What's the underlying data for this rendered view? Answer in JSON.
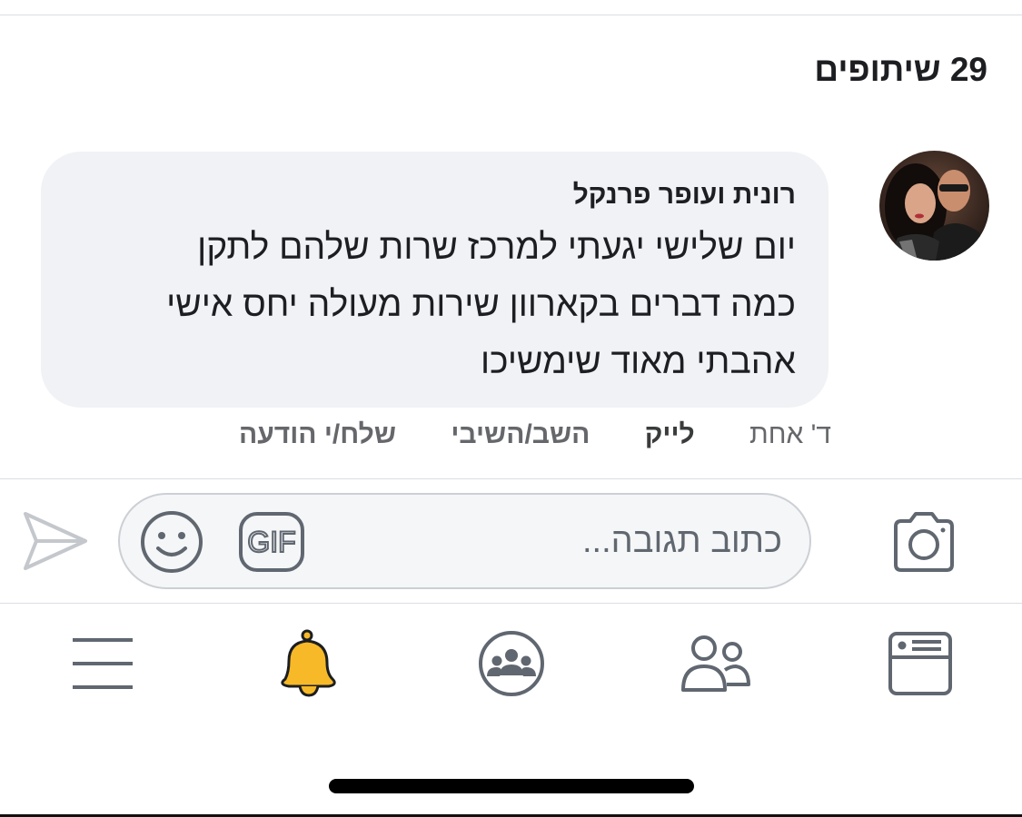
{
  "shares": {
    "label": "29 שיתופים"
  },
  "comment": {
    "author": "רונית ועופר פרנקל",
    "lines": [
      "יום שלישי יגעתי למרכז שרות שלהם לתקן",
      "כמה דברים בקארוון שירות מעולה יחס אישי",
      "אהבתי מאוד שימשיכו"
    ],
    "time": "ד' אחת",
    "like": "לייק",
    "reply": "השב/השיבי",
    "message": "שלח/י הודעה"
  },
  "composer": {
    "placeholder": "כתוב תגובה...",
    "gif_label": "GIF",
    "camera_icon": "camera-icon",
    "emoji_icon": "smiley-icon",
    "send_icon": "send-arrow-icon"
  },
  "tabbar": {
    "icons": [
      "menu-icon",
      "bell-icon",
      "groups-icon",
      "friends-icon",
      "news-feed-icon"
    ],
    "active_color": "#f7b928"
  },
  "colors": {
    "bubble": "#f0f2f5",
    "icon_gray": "#606770"
  }
}
